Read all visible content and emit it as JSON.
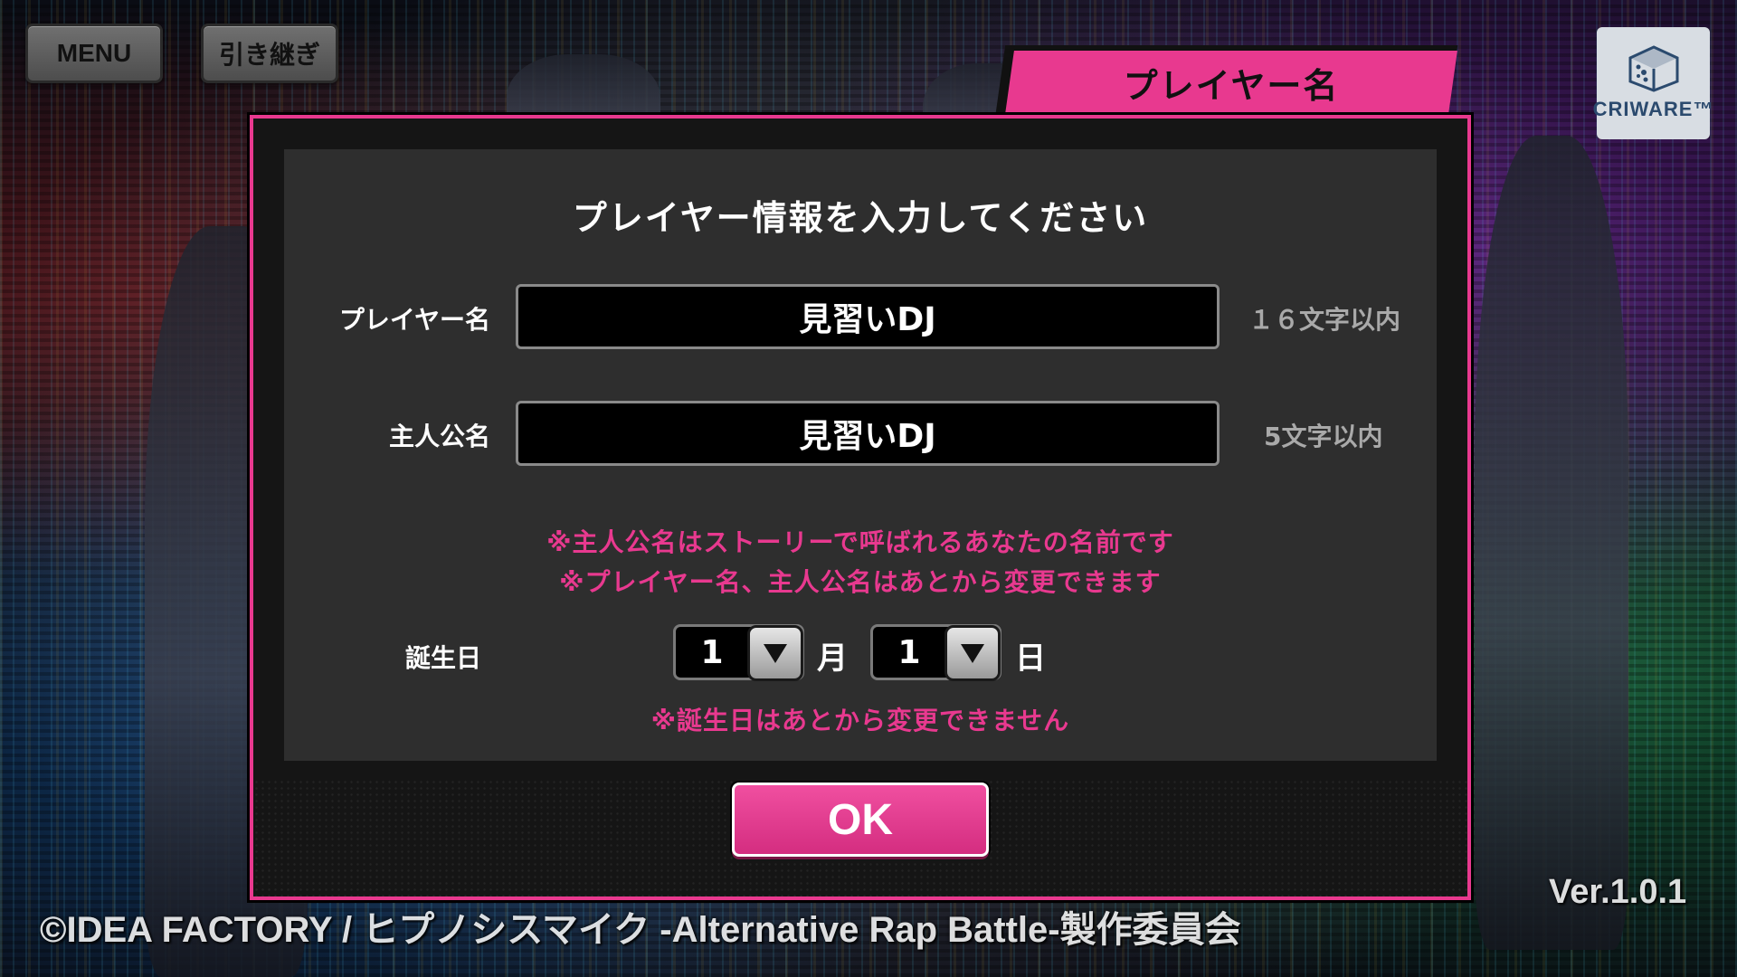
{
  "top_bar": {
    "menu_label": "MENU",
    "handover_label": "引き継ぎ"
  },
  "criware": {
    "label": "CRIWARE™",
    "icon": "criware-cube-icon"
  },
  "dialog": {
    "tab_title": "プレイヤー名",
    "heading": "プレイヤー情報を入力してください",
    "player_name": {
      "label": "プレイヤー名",
      "value": "見習いDJ",
      "limit": "１６文字以内"
    },
    "hero_name": {
      "label": "主人公名",
      "value": "見習いDJ",
      "limit": "5文字以内"
    },
    "notes": [
      "※主人公名はストーリーで呼ばれるあなたの名前です",
      "※プレイヤー名、主人公名はあとから変更できます"
    ],
    "birthday": {
      "label": "誕生日",
      "month_value": "1",
      "month_unit": "月",
      "day_value": "1",
      "day_unit": "日",
      "note": "※誕生日はあとから変更できません"
    },
    "ok_label": "OK"
  },
  "footer": {
    "copyright": "©IDEA FACTORY / ヒプノシスマイク -Alternative Rap Battle-製作委員会",
    "version": "Ver.1.0.1"
  },
  "colors": {
    "accent": "#e8398f",
    "panel": "#2e2e2e",
    "modal": "#151515"
  }
}
